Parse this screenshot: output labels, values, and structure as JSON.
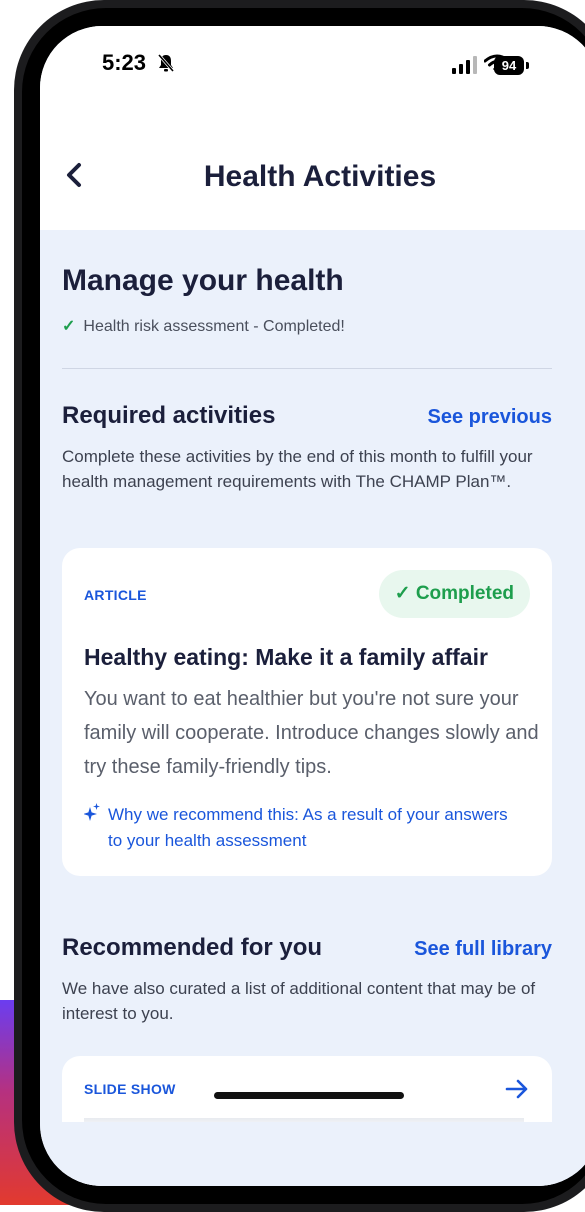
{
  "status_bar": {
    "time": "5:23",
    "battery": "94"
  },
  "nav": {
    "title": "Health Activities"
  },
  "manage": {
    "title": "Manage your health",
    "status": "Health risk assessment - Completed!"
  },
  "required": {
    "title": "Required activities",
    "link": "See previous",
    "description": "Complete these activities by the end of this month to fulfill your health management requirements with The CHAMP Plan™.",
    "card": {
      "tag": "ARTICLE",
      "badge": "Completed",
      "title": "Healthy eating: Make it a family affair",
      "body": "You want to eat healthier but you're not sure your family will cooperate. Introduce changes slowly and try these family-friendly tips.",
      "why": "Why we recommend this: As a result of your answers to your health assessment"
    }
  },
  "recommended": {
    "title": "Recommended for you",
    "link": "See full library",
    "description": "We have also curated a list of additional content that may be of interest to you.",
    "card": {
      "tag": "SLIDE SHOW"
    }
  },
  "colors": {
    "accent": "#1a56db",
    "success": "#1e9e4d",
    "page_bg": "#ebf1fb",
    "text": "#1b1f3b"
  },
  "icons": [
    "bell-slash-icon",
    "cellular-signal-icon",
    "wifi-icon",
    "battery-icon",
    "back-chevron-icon",
    "checkmark-icon",
    "sparkle-icon",
    "arrow-right-icon"
  ]
}
